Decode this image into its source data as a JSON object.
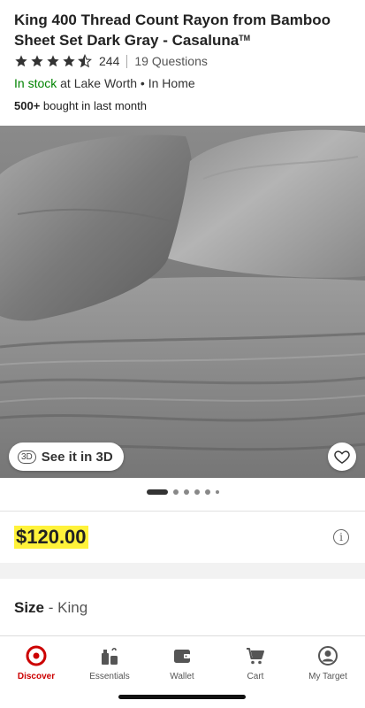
{
  "product": {
    "title": "King 400 Thread Count Rayon from Bamboo Sheet Set Dark Gray - Casaluna",
    "trademark": "TM",
    "rating": 4.5,
    "rating_count": "244",
    "questions": "19 Questions",
    "stock_status": "In stock",
    "stock_location": " at Lake Worth",
    "fulfillment": " • In Home",
    "bought_count": "500+",
    "bought_text": " bought in last month",
    "price": "$120.00",
    "size_label": "Size",
    "size_value": " - King"
  },
  "gallery": {
    "view_3d_label": "See it in 3D",
    "icon_3d_text": "3D",
    "image_count": 6,
    "active_index": 0,
    "favorite_icon": "heart-outline-icon"
  },
  "tabbar": {
    "tabs": [
      {
        "label": "Discover",
        "icon": "target-bullseye-icon",
        "active": true
      },
      {
        "label": "Essentials",
        "icon": "essentials-icon",
        "active": false
      },
      {
        "label": "Wallet",
        "icon": "wallet-icon",
        "active": false
      },
      {
        "label": "Cart",
        "icon": "cart-icon",
        "active": false
      },
      {
        "label": "My Target",
        "icon": "account-icon",
        "active": false
      }
    ]
  },
  "colors": {
    "brand_red": "#cc0000",
    "stock_green": "#008300",
    "price_highlight": "#fff23a"
  }
}
